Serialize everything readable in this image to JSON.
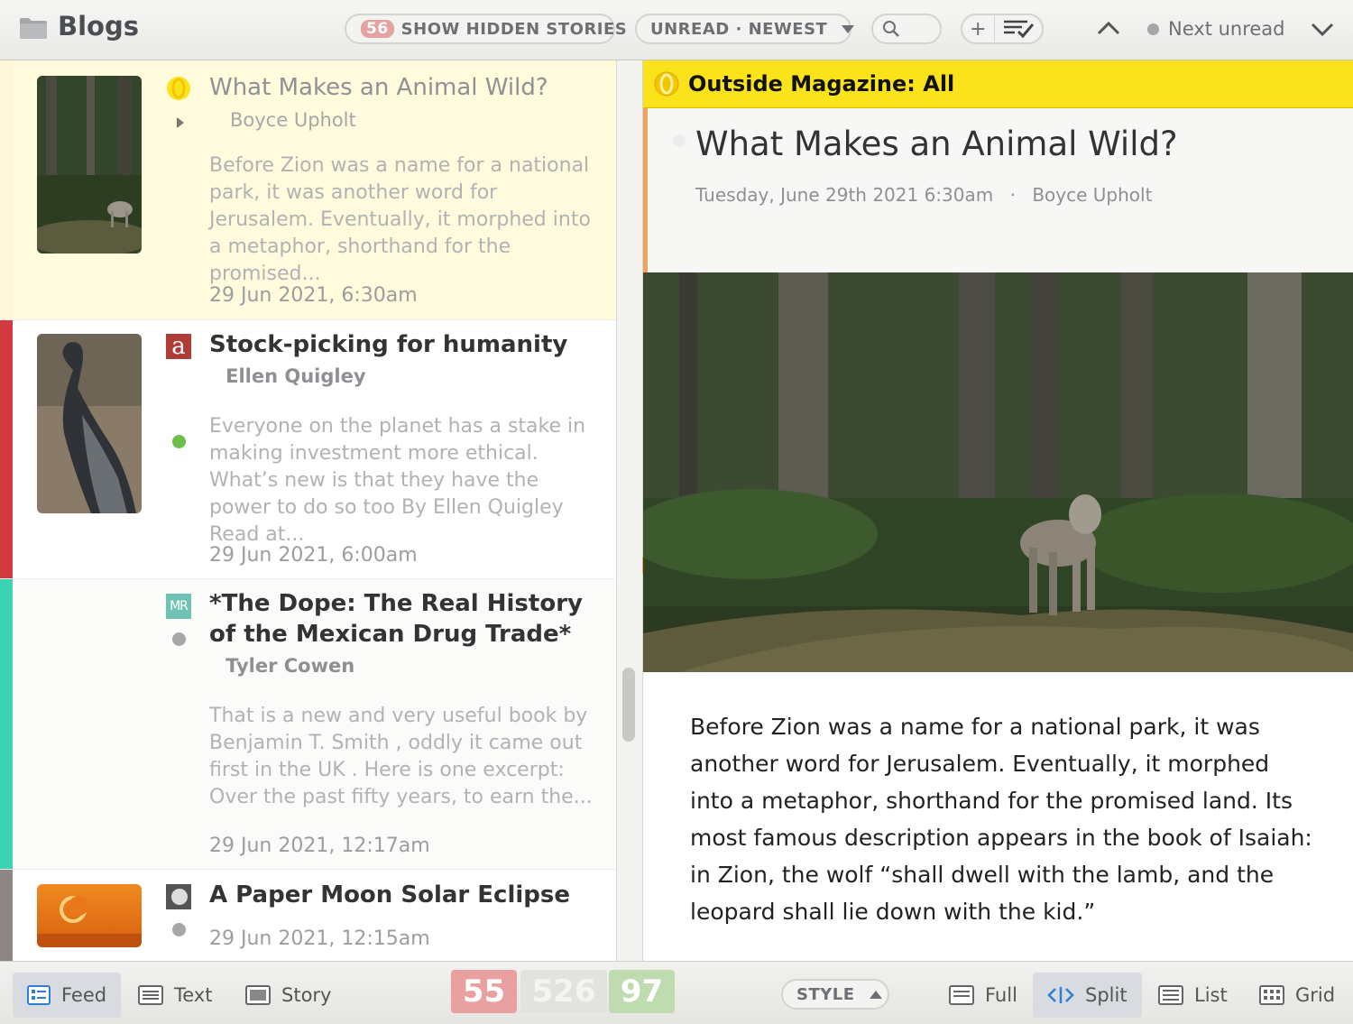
{
  "header": {
    "title": "Blogs",
    "hidden_count": "56",
    "hidden_label": "SHOW HIDDEN STORIES",
    "order_label": "UNREAD · NEWEST",
    "add_label": "+",
    "next_unread_label": "Next unread"
  },
  "stories": [
    {
      "title": "What Makes an Animal Wild?",
      "author": "Boyce Upholt",
      "snippet": "Before Zion was a name for a national park, it was another word for Jerusalem. Eventually, it morphed into a metaphor, shorthand for the promised...",
      "date": "29 Jun 2021, 6:30am",
      "bar_color": "#fdf9d8",
      "favicon": "outside-logo-icon"
    },
    {
      "title": "Stock-picking for humanity",
      "author": "Ellen Quigley",
      "snippet": "Everyone on the planet has a stake in making investment more ethical. What’s new is that they have the power to do so too By Ellen Quigley Read at...",
      "date": "29 Jun 2021, 6:00am",
      "bar_color": "#d23a3f",
      "favicon": "aeon-logo-icon",
      "favicon_text": "a"
    },
    {
      "title": "*The Dope: The Real History of the Mexican Drug Trade*",
      "author": "Tyler Cowen",
      "snippet": "That is a new and very useful book by Benjamin T. Smith , oddly it came out first in the UK . Here is one excerpt: Over the past fifty years, to earn the...",
      "date": "29 Jun 2021, 12:17am",
      "bar_color": "#3cd3b3",
      "favicon": "mr-logo-icon",
      "favicon_text": "MR"
    },
    {
      "title": "A Paper Moon Solar Eclipse",
      "date": "29 Jun 2021, 12:15am",
      "bar_color": "#8f8583",
      "favicon": "apod-logo-icon"
    }
  ],
  "detail": {
    "feed_title": "Outside Magazine: All",
    "title": "What Makes an Animal Wild?",
    "date": "Tuesday, June 29th 2021 6:30am",
    "separator": "·",
    "author": "Boyce Upholt",
    "body": "Before Zion was a name for a national park, it was another word for Jerusalem. Eventually, it morphed into a metaphor, shorthand for the promised land. Its most famous description appears in the book of Isaiah: in Zion, the wolf “shall dwell with the lamb, and the leopard shall lie down with the kid.”"
  },
  "footer": {
    "views": [
      "Feed",
      "Text",
      "Story"
    ],
    "counts": {
      "unread": "55",
      "total": "526",
      "starred": "97"
    },
    "style_label": "STYLE",
    "layouts": [
      "Full",
      "Split",
      "List",
      "Grid"
    ]
  },
  "colors": {
    "accent_yellow": "#fbe31c",
    "count_red": "#e8a0a0",
    "count_grey": "#e2e2df",
    "count_green": "#bfdcb0",
    "active_view": "#d8dbdf"
  }
}
